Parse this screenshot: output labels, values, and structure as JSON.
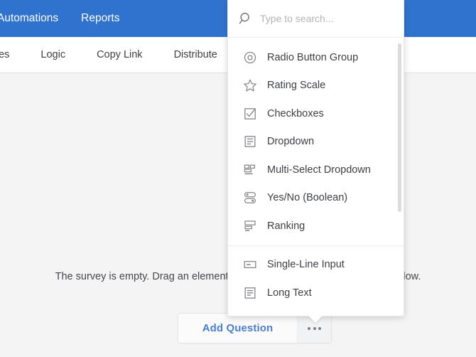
{
  "topbar": {
    "background_color": "#3073cf",
    "items": [
      {
        "label": "Automations"
      },
      {
        "label": "Reports"
      }
    ]
  },
  "tabbar": {
    "items": [
      {
        "label": "mes"
      },
      {
        "label": "Logic"
      },
      {
        "label": "Copy Link"
      },
      {
        "label": "Distribute"
      }
    ]
  },
  "content": {
    "empty_message": "The survey is empty. Drag an element from the toolbox or click the button below."
  },
  "add_question": {
    "label": "Add Question",
    "accent_color": "#4a7fd4",
    "more_icon": "ellipsis-icon"
  },
  "dropdown": {
    "search": {
      "placeholder": "Type to search...",
      "value": "",
      "icon": "search-icon"
    },
    "groups": [
      {
        "items": [
          {
            "label": "Radio Button Group",
            "icon": "radio-button-icon"
          },
          {
            "label": "Rating Scale",
            "icon": "star-icon"
          },
          {
            "label": "Checkboxes",
            "icon": "checkbox-icon"
          },
          {
            "label": "Dropdown",
            "icon": "dropdown-list-icon"
          },
          {
            "label": "Multi-Select Dropdown",
            "icon": "multi-select-icon"
          },
          {
            "label": "Yes/No (Boolean)",
            "icon": "toggle-switch-icon"
          },
          {
            "label": "Ranking",
            "icon": "ranking-icon"
          }
        ]
      },
      {
        "items": [
          {
            "label": "Single-Line Input",
            "icon": "single-line-input-icon"
          },
          {
            "label": "Long Text",
            "icon": "long-text-icon"
          }
        ]
      }
    ]
  }
}
